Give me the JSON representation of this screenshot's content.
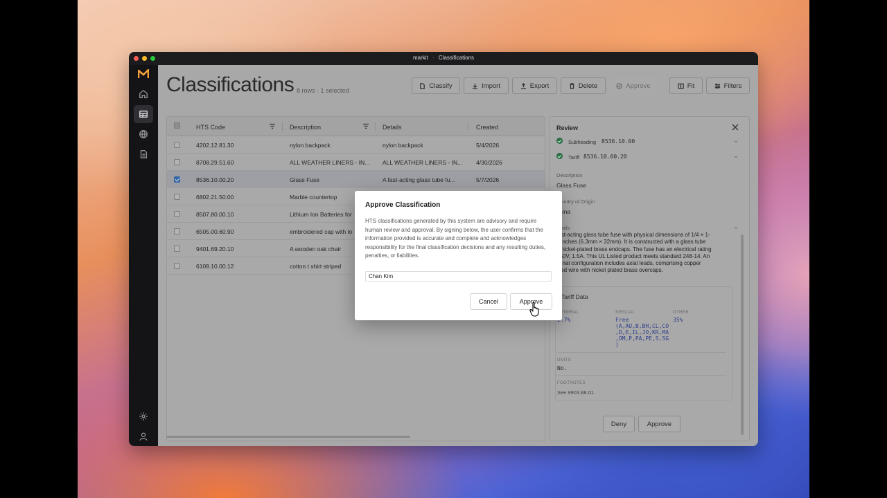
{
  "window": {
    "title_app": "markit",
    "title_sep": "·",
    "title_page": "Classifications"
  },
  "sidebar": {
    "items": [
      "home-icon",
      "table-icon",
      "globe-icon",
      "document-icon"
    ],
    "footer": [
      "settings-icon",
      "user-icon"
    ]
  },
  "header": {
    "title": "Classifications",
    "row_info": "8 rows · 1 selected"
  },
  "toolbar": {
    "classify": "Classify",
    "import": "Import",
    "export": "Export",
    "delete": "Delete",
    "approve": "Approve",
    "fit": "Fit",
    "filters": "Filters"
  },
  "table": {
    "columns": [
      "HTS Code",
      "Description",
      "Details",
      "Created"
    ],
    "rows": [
      {
        "code": "4202.12.81.30",
        "description": "nylon backpack",
        "details": "nylon backpack",
        "created": "5/4/2026",
        "selected": false
      },
      {
        "code": "8708.29.51.60",
        "description": "ALL WEATHER LINERS - IN...",
        "details": "ALL WEATHER LINERS - IN...",
        "created": "4/30/2026",
        "selected": false
      },
      {
        "code": "8536.10.00.20",
        "description": "Glass Fuse",
        "details": "A fast-acting glass tube fu...",
        "created": "5/7/2026",
        "selected": true
      },
      {
        "code": "6802.21.50.00",
        "description": "Marble countertop",
        "details": "",
        "created": "",
        "selected": false
      },
      {
        "code": "8507.80.00.10",
        "description": "Lithium Ion Batteries for",
        "details": "",
        "created": "",
        "selected": false
      },
      {
        "code": "6505.00.60.90",
        "description": "embroidered cap with lo",
        "details": "",
        "created": "",
        "selected": false
      },
      {
        "code": "9401.69.20.10",
        "description": "A wooden oak chair",
        "details": "",
        "created": "",
        "selected": false
      },
      {
        "code": "6109.10.00.12",
        "description": "cotton t shirt striped",
        "details": "",
        "created": "",
        "selected": false
      }
    ]
  },
  "review": {
    "title": "Review",
    "subheading_label": "Subheading",
    "subheading_value": "8536.10.00",
    "tariff_label": "Tariff",
    "tariff_value": "8536.10.00.20",
    "description_label": "Description",
    "description_value": "Glass Fuse",
    "origin_label": "ountry of Origin",
    "origin_value": "hina",
    "details_label": "ails",
    "details_lines": [
      "fast-acting glass tube fuse with physical dimensions of 1/4 × 1-",
      "4 inches (6.3mm × 32mm). It is constructed with a glass tube",
      "d nickel-plated brass endcaps. The fuse has an electrical rating",
      "250V, 1.5A. This UL Listed product meets standard 248-14. An",
      "tional configuration includes axial leads, comprising copper",
      "ined wire with nickel plated brass overcaps."
    ],
    "tariff_data_title": "Tariff Data",
    "general_label": "GENERAL",
    "general_value": "2.7%",
    "special_label": "SPECIAL",
    "special_lines": [
      "Free",
      "(A,AU,B,BH,CL,CO",
      ",D,E,IL,JO,KR,MA",
      ",OM,P,PA,PE,S,SG",
      ")"
    ],
    "other_label": "OTHER",
    "other_value": "35%",
    "units_label": "UNITS",
    "units_value": "No.",
    "footnotes_label": "FOOTNOTES",
    "footnotes_value": "See 9903.88.01.",
    "deny": "Deny",
    "approve": "Approve"
  },
  "modal": {
    "title": "Approve Classification",
    "text": "HTS classifications generated by this system are advisory and require human review and approval. By signing below, the user confirms that the information provided is accurate and complete and acknowledges responsibility for the final classification decisions and any resulting duties, penalties, or liabilities.",
    "signature_value": "Chan Kim",
    "cancel": "Cancel",
    "approve": "Approve"
  }
}
